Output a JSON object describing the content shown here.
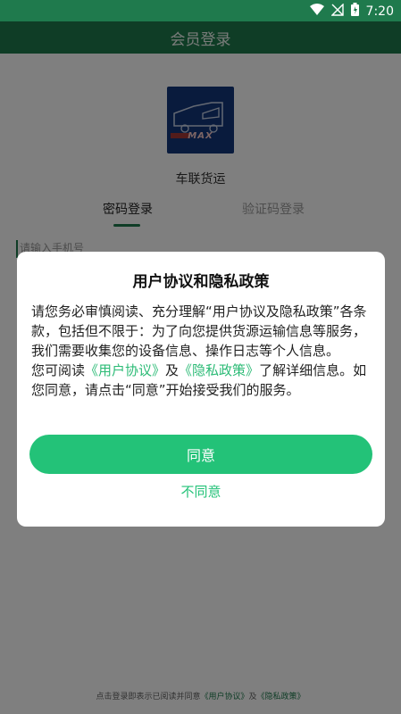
{
  "status_bar": {
    "time": "7:20",
    "icons": [
      "wifi-icon",
      "signal-off-icon",
      "battery-icon"
    ]
  },
  "app_bar": {
    "title": "会员登录"
  },
  "login": {
    "logo_text": "MAX",
    "app_name": "车联货运",
    "tabs": [
      "密码登录",
      "验证码登录"
    ],
    "active_tab": 0,
    "phone_placeholder": "请输入手机号"
  },
  "footer": {
    "prefix": "点击登录即表示已阅读并同意",
    "user_agreement": "《用户协议》",
    "and": "及",
    "privacy_policy": "《隐私政策》"
  },
  "dialog": {
    "title": "用户协议和隐私政策",
    "paragraph1": "请您务必审慎阅读、充分理解“用户协议及隐私政策”各条款，包括但不限于：为了向您提供货源运输信息等服务，我们需要收集您的设备信息、操作日志等个人信息。",
    "paragraph2_prefix": "您可阅读",
    "user_agreement_link": "《用户协议》",
    "and": "及",
    "privacy_policy_link": "《隐私政策》",
    "paragraph2_suffix": "了解详细信息。如您同意，请点击“同意”开始接受我们的服务。",
    "agree_label": "同意",
    "disagree_label": "不同意"
  },
  "colors": {
    "primary_green": "#1f7a4d",
    "accent_green": "#23c278",
    "logo_blue": "#12367a"
  }
}
